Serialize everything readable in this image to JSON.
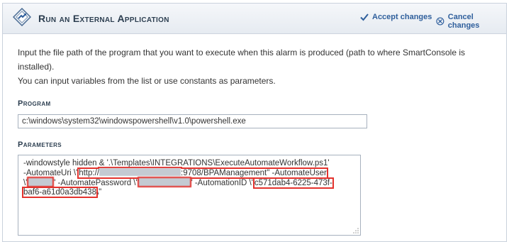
{
  "header": {
    "title": "Run an External Application",
    "accept_label": "Accept changes",
    "cancel_label": "Cancel changes"
  },
  "intro": {
    "line1": "Input the file path of the program that you want to execute when this alarm is produced (path to where SmartConsole is installed).",
    "line2": "You can input variables from the list or use constants as parameters."
  },
  "program": {
    "label": "Program",
    "value": "c:\\windows\\system32\\windowspowershell\\v1.0\\powershell.exe"
  },
  "parameters": {
    "label": "Parameters",
    "line1": "-windowstyle hidden & '.\\Templates\\INTEGRATIONS\\ExecuteAutomateWorkflow.ps1'",
    "line2_a": "-AutomateUri \\\"",
    "line2_url_start": "http://",
    "line2_url_end": ":9708/BPAManagement\" -AutomateUser",
    "line3_a": "\\\"",
    "line3_b": "\" -AutomatePassword \\\"",
    "line3_c": "\" -AutomationID \\\"",
    "line3_id": "c571dab4-6225-473f-",
    "line4_id": "baf6-a61d0a3db438",
    "line4_end": "\\\""
  },
  "colors": {
    "accent": "#2f5f9c",
    "highlight": "#e3322d"
  },
  "icons": {
    "app": "diamond-arrow-icon",
    "accept": "checkmark-icon",
    "cancel": "cancel-x-icon"
  }
}
